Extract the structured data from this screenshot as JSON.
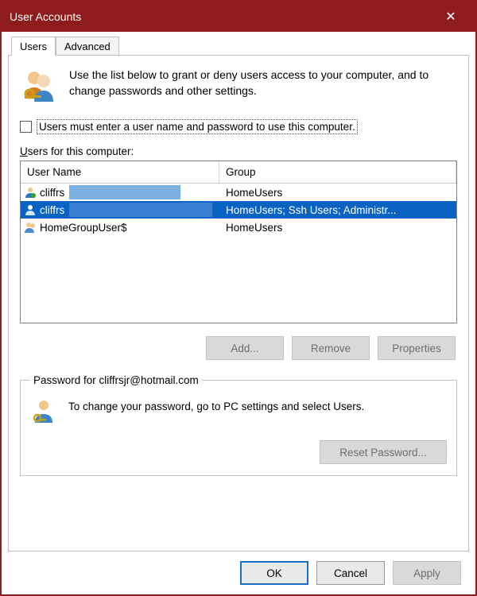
{
  "window": {
    "title": "User Accounts"
  },
  "tabs": {
    "users": "Users",
    "advanced": "Advanced"
  },
  "intro": "Use the list below to grant or deny users access to your computer, and to change passwords and other settings.",
  "checkbox": "Users must enter a user name and password to use this computer.",
  "list_label_pre": "U",
  "list_label_rest": "sers for this computer:",
  "columns": {
    "user": "User Name",
    "group": "Group"
  },
  "rows": [
    {
      "name": "cliffrs",
      "group": "HomeUsers",
      "blurred": true,
      "selected": false
    },
    {
      "name": "cliffrs",
      "group": "HomeUsers; Ssh Users; Administr...",
      "blurred": true,
      "selected": true
    },
    {
      "name": "HomeGroupUser$",
      "group": "HomeUsers",
      "blurred": false,
      "selected": false
    }
  ],
  "btns": {
    "add": "Add...",
    "remove": "Remove",
    "props": "Properties",
    "reset": "Reset Password..."
  },
  "pwd_legend": "Password for cliffrsjr@hotmail.com",
  "pwd_text": "To change your password, go to PC settings and select Users.",
  "footer": {
    "ok": "OK",
    "cancel": "Cancel",
    "apply": "Apply"
  }
}
